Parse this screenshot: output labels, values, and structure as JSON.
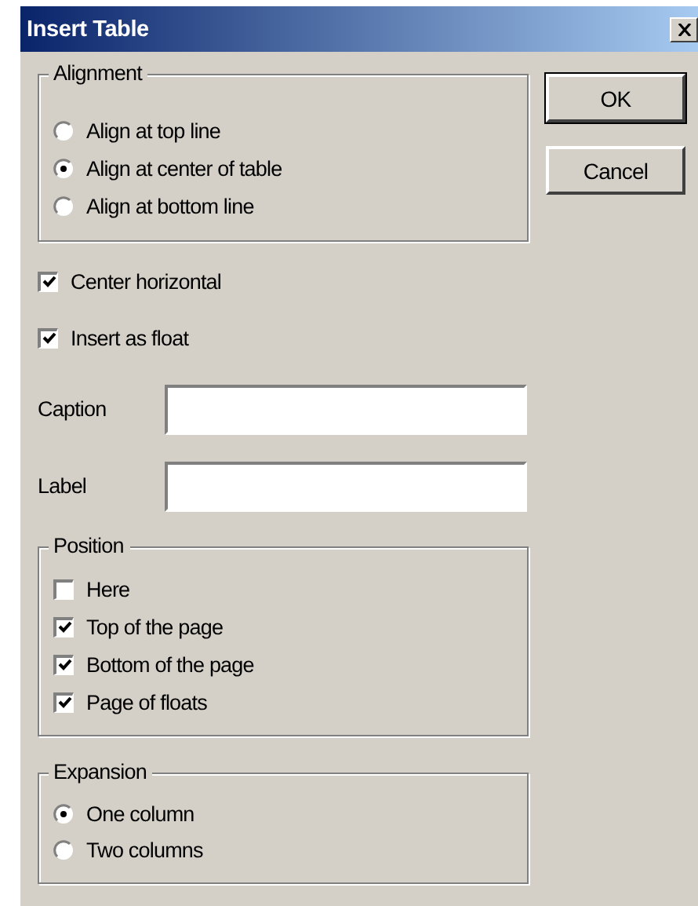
{
  "window": {
    "title": "Insert Table"
  },
  "alignment": {
    "title": "Alignment",
    "options": [
      {
        "label": "Align at top line",
        "selected": false
      },
      {
        "label": "Align at center of table",
        "selected": true
      },
      {
        "label": "Align at bottom line",
        "selected": false
      }
    ]
  },
  "options": [
    {
      "label": "Center horizontal",
      "checked": true
    },
    {
      "label": "Insert as float",
      "checked": true
    }
  ],
  "fields": [
    {
      "label": "Caption"
    },
    {
      "label": "Label"
    }
  ],
  "position": {
    "title": "Position",
    "options": [
      {
        "label": "Here",
        "checked": false
      },
      {
        "label": "Top of the page",
        "checked": true
      },
      {
        "label": "Bottom of the page",
        "checked": true
      },
      {
        "label": "Page of floats",
        "checked": true
      }
    ]
  },
  "expansion": {
    "title": "Expansion",
    "options": [
      {
        "label": "One column",
        "selected": true
      },
      {
        "label": "Two columns",
        "selected": false
      }
    ]
  },
  "buttons": [
    {
      "label": "OK",
      "default": true
    },
    {
      "label": "Cancel",
      "default": false
    }
  ]
}
